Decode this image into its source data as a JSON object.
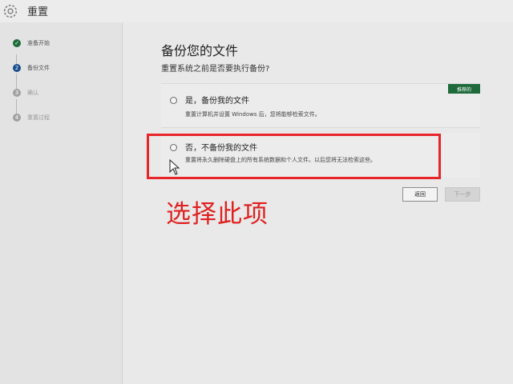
{
  "window": {
    "title": "重置",
    "icon": "gear-icon"
  },
  "sidebar": {
    "steps": [
      {
        "label": "准备开始",
        "status": "done",
        "marker": "✓"
      },
      {
        "label": "备份文件",
        "status": "current",
        "marker": "2"
      },
      {
        "label": "确认",
        "status": "pending",
        "marker": "3"
      },
      {
        "label": "重置过程",
        "status": "pending",
        "marker": "4"
      }
    ]
  },
  "main": {
    "heading": "备份您的文件",
    "subheading": "重置系统之前是否要执行备份?",
    "options": [
      {
        "title": "是，备份我的文件",
        "description": "重置计算机并设置 Windows 后，您将能够检索文件。",
        "badge": "推荐的",
        "selected": false
      },
      {
        "title": "否，不备份我的文件",
        "description": "重置将永久删除硬盘上的所有系统数据和个人文件。以后您将无法检索这些。",
        "selected": false
      }
    ],
    "buttons": {
      "back": "返回",
      "next": "下一步",
      "next_enabled": false
    }
  },
  "annotation": {
    "text": "选择此项",
    "color": "#e02020"
  },
  "colors": {
    "accent_green": "#1f6a3a",
    "accent_blue": "#174a8c",
    "highlight_red": "#e8262a"
  }
}
